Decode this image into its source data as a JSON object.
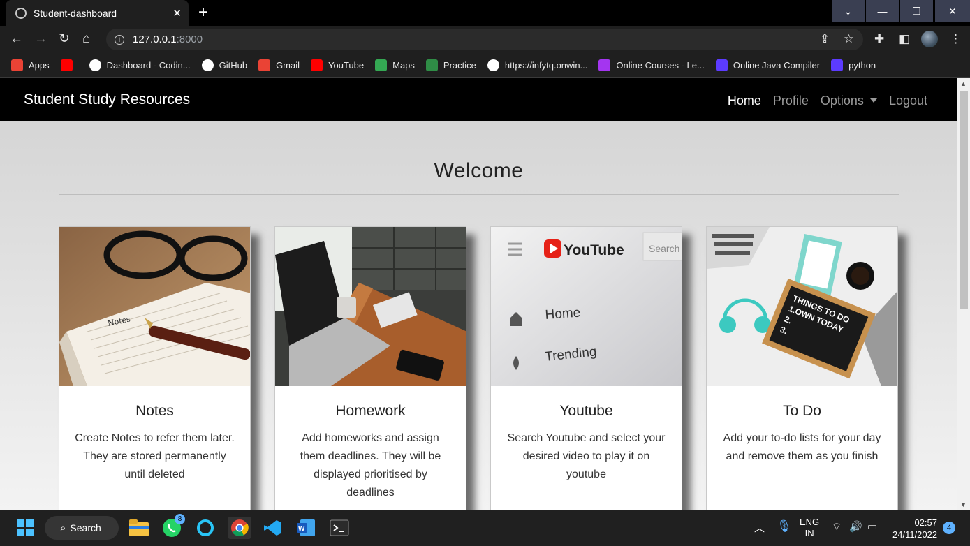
{
  "browser": {
    "tab_title": "Student-dashboard",
    "tab_close": "✕",
    "new_tab": "+",
    "url_host": "127.0.0.1",
    "url_port": ":8000",
    "bookmarks": [
      {
        "label": "Apps",
        "icon": "apps-grid-icon",
        "color": "#ea4335"
      },
      {
        "label": "",
        "icon": "youtube-icon",
        "color": "#ff0000"
      },
      {
        "label": "Dashboard - Codin...",
        "icon": "codingninjas-icon",
        "color": "#ffffff"
      },
      {
        "label": "GitHub",
        "icon": "github-icon",
        "color": "#ffffff"
      },
      {
        "label": "Gmail",
        "icon": "gmail-icon",
        "color": "#ea4335"
      },
      {
        "label": "YouTube",
        "icon": "youtube-icon",
        "color": "#ff0000"
      },
      {
        "label": "Maps",
        "icon": "maps-icon",
        "color": "#34a853"
      },
      {
        "label": "Practice",
        "icon": "geeksforgeeks-icon",
        "color": "#2f8d46"
      },
      {
        "label": "https://infytq.onwin...",
        "icon": "infytq-icon",
        "color": "#ffffff"
      },
      {
        "label": "Online Courses - Le...",
        "icon": "udemy-icon",
        "color": "#a435f0"
      },
      {
        "label": "Online Java Compiler",
        "icon": "programiz-icon",
        "color": "#5c3bff"
      },
      {
        "label": "python",
        "icon": "programiz-icon",
        "color": "#5c3bff"
      }
    ]
  },
  "site": {
    "brand": "Student Study Resources",
    "nav": {
      "home": "Home",
      "profile": "Profile",
      "options": "Options",
      "logout": "Logout"
    },
    "welcome": "Welcome",
    "cards": [
      {
        "title": "Notes",
        "text": "Create Notes to refer them later. They are stored permanently until deleted",
        "image": "notebook-glasses-pen-photo"
      },
      {
        "title": "Homework",
        "text": "Add homeworks and assign them deadlines. They will be displayed prioritised by deadlines",
        "image": "laptop-desk-coffee-photo"
      },
      {
        "title": "Youtube",
        "text": "Search Youtube and select your desired video to play it on youtube",
        "image": "youtube-screen-photo",
        "photo_text": {
          "logo": "YouTube",
          "search": "Search",
          "home": "Home",
          "trending": "Trending"
        }
      },
      {
        "title": "To Do",
        "text": "Add your to-do lists for your day and remove them as you finish",
        "image": "todo-letterboard-photo",
        "photo_text": {
          "board": "THINGS TO DO\n1.OWN TODAY\n2.\n3."
        }
      }
    ]
  },
  "taskbar": {
    "search_label": "Search",
    "whatsapp_badge": "8",
    "language": "ENG",
    "region": "IN",
    "time": "02:57",
    "date": "24/11/2022",
    "notifications": "4"
  }
}
